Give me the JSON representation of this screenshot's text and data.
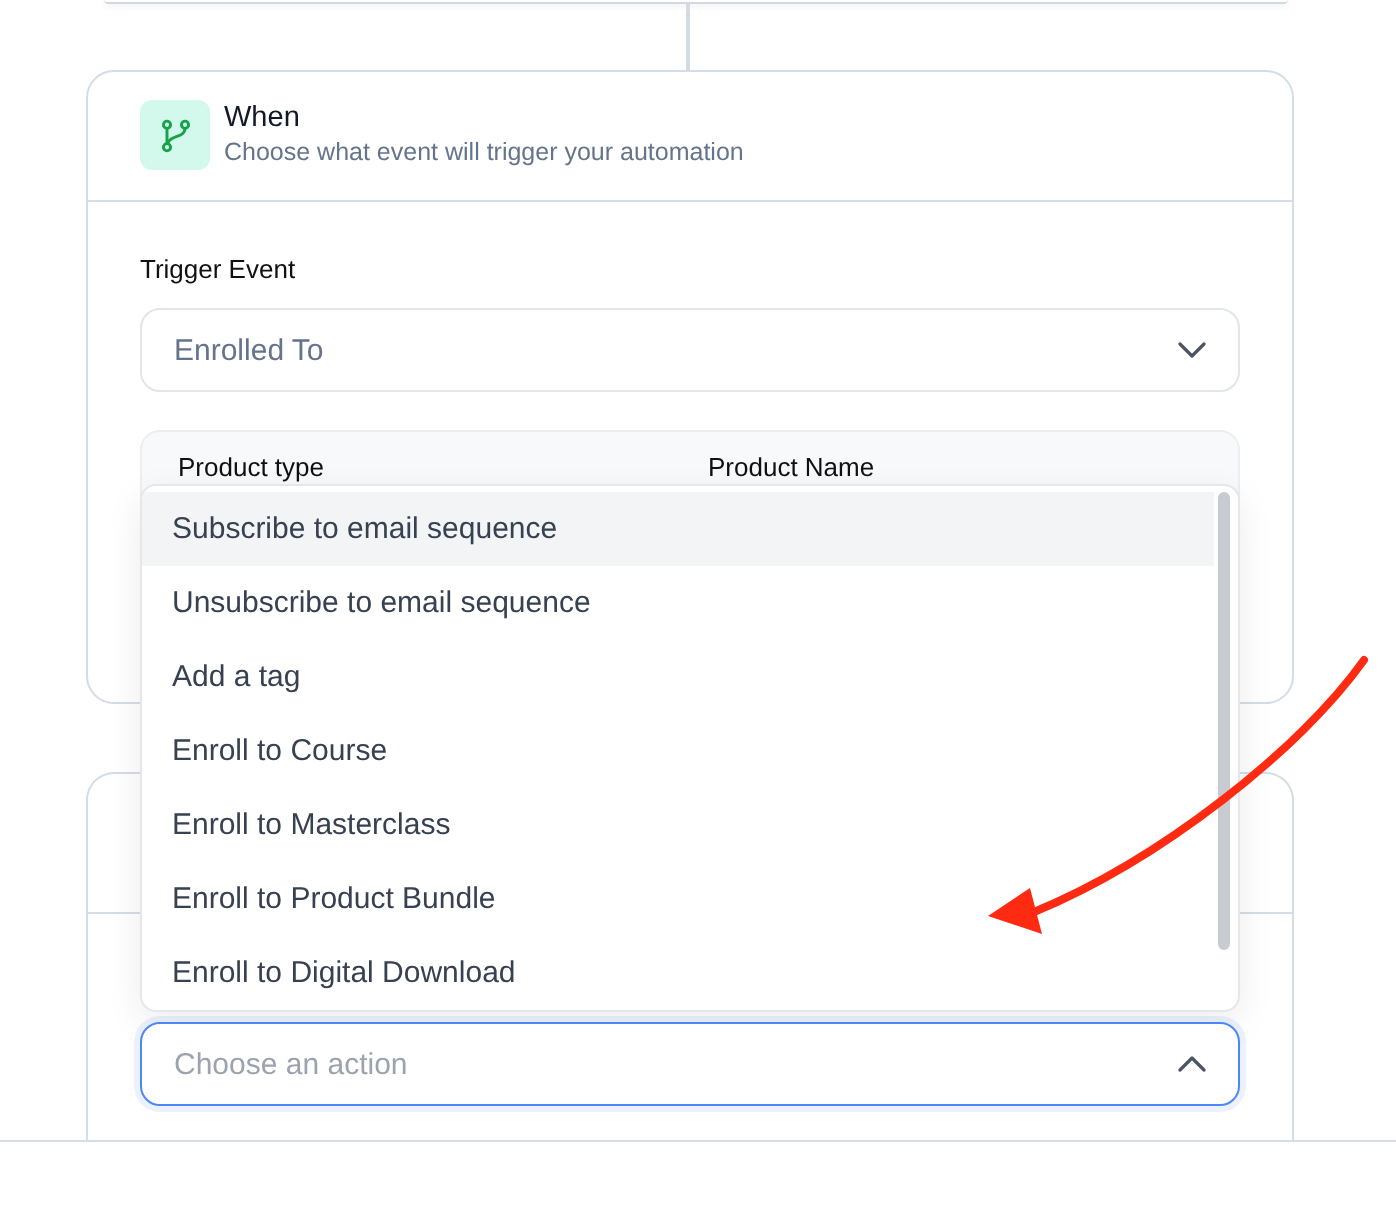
{
  "trigger_card": {
    "title": "When",
    "subtitle": "Choose what event will trigger your automation",
    "field_label": "Trigger Event",
    "select": {
      "value": "Enrolled To",
      "expanded": false
    },
    "product_table": {
      "columns": [
        "Product type",
        "Product Name"
      ]
    }
  },
  "action_card": {
    "select": {
      "placeholder": "Choose an action",
      "expanded": true,
      "options": [
        {
          "label": "Subscribe to email sequence",
          "selected": true
        },
        {
          "label": "Unsubscribe to email sequence",
          "selected": false
        },
        {
          "label": "Add a tag",
          "selected": false
        },
        {
          "label": "Enroll to Course",
          "selected": false
        },
        {
          "label": "Enroll to Masterclass",
          "selected": false
        },
        {
          "label": "Enroll to Product Bundle",
          "selected": false
        },
        {
          "label": "Enroll to Digital Download",
          "selected": false
        }
      ]
    }
  }
}
